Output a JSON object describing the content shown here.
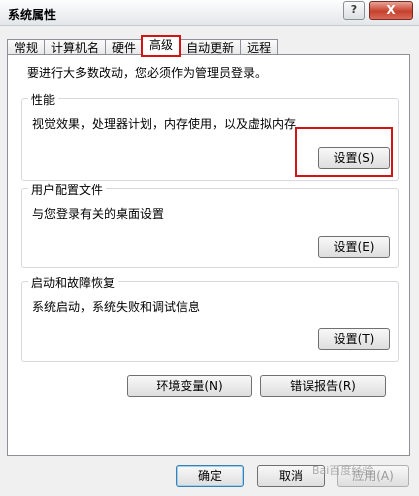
{
  "window": {
    "title": "系统属性",
    "help_label": "?",
    "close_label": "X"
  },
  "tabs": [
    {
      "label": "常规"
    },
    {
      "label": "计算机名"
    },
    {
      "label": "硬件"
    },
    {
      "label": "高级"
    },
    {
      "label": "自动更新"
    },
    {
      "label": "远程"
    }
  ],
  "active_tab": "高级",
  "admin_note": "要进行大多数改动，您必须作为管理员登录。",
  "performance": {
    "title": "性能",
    "description": "视觉效果，处理器计划，内存使用，以及虚拟内存",
    "button_label": "设置(S)"
  },
  "user_profiles": {
    "title": "用户配置文件",
    "description": "与您登录有关的桌面设置",
    "button_label": "设置(E)"
  },
  "startup_recovery": {
    "title": "启动和故障恢复",
    "description": "系统启动，系统失败和调试信息",
    "button_label": "设置(T)"
  },
  "env_vars_label": "环境变量(N)",
  "error_report_label": "错误报告(R)",
  "footer": {
    "ok_label": "确定",
    "cancel_label": "取消",
    "apply_label": "应用(A)"
  },
  "watermark": "Bai百度经验",
  "highlight_color": "#d31414"
}
